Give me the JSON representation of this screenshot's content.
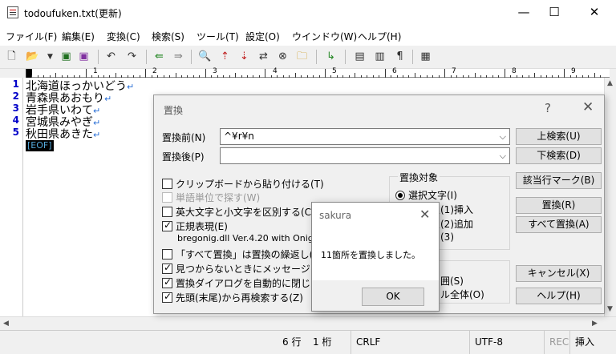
{
  "window": {
    "title": "todoufuken.txt(更新)",
    "minimize": "—",
    "maximize": "☐",
    "close": "✕"
  },
  "menu": [
    "ファイル(F)",
    "編集(E)",
    "変換(C)",
    "検索(S)",
    "ツール(T)",
    "設定(O)",
    "ウインドウ(W)",
    "ヘルプ(H)"
  ],
  "ruler": [
    "1",
    "2",
    "3",
    "4",
    "5",
    "6",
    "7",
    "8",
    "9"
  ],
  "editor": {
    "lines": [
      {
        "no": "1",
        "text": "北海道ほっかいどう"
      },
      {
        "no": "2",
        "text": "青森県あおもり"
      },
      {
        "no": "3",
        "text": "岩手県いわて"
      },
      {
        "no": "4",
        "text": "宮城県みやぎ"
      },
      {
        "no": "5",
        "text": "秋田県あきた"
      }
    ],
    "newline_mark": "↵",
    "eof": "[EOF]"
  },
  "status": {
    "row": "6 行",
    "col": "1 桁",
    "eol": "CRLF",
    "encoding": "UTF-8",
    "rec": "REC",
    "mode": "挿入"
  },
  "dialog": {
    "title": "置換",
    "help": "?",
    "close": "✕",
    "find_label": "置換前(N)",
    "find_value": "^¥r¥n",
    "replace_label": "置換後(P)",
    "replace_value": "",
    "options": {
      "paste_clipboard": "クリップボードから貼り付ける(T)",
      "word_only": "単語単位で探す(W)",
      "case_sensitive": "英大文字と小文字を区別する(C)",
      "regex": "正規表現(E)",
      "regex_lib": "bregonig.dll Ver.4.20 with Onig",
      "loop_replace": "「すべて置換」は置換の繰返し(",
      "show_message": "見つからないときにメッセージを",
      "auto_close": "置換ダイアログを自動的に閉じ",
      "wrap_search": "先頭(末尾)から再検索する(Z)"
    },
    "target": {
      "group_label": "置換対象",
      "select_text": "選択文字(I)",
      "insert": "点(1)挿入",
      "append": "点(2)追加",
      "line": "(3)"
    },
    "range": {
      "selection": "囲(S)",
      "whole": "ル全体(O)"
    },
    "buttons": {
      "find_up": "上検索(U)",
      "find_down": "下検索(D)",
      "mark": "該当行マーク(B)",
      "replace": "置換(R)",
      "replace_all": "すべて置換(A)",
      "cancel": "キャンセル(X)",
      "help": "ヘルプ(H)"
    }
  },
  "message": {
    "title": "sakura",
    "close": "✕",
    "text": "11箇所を置換しました。",
    "ok": "OK"
  }
}
